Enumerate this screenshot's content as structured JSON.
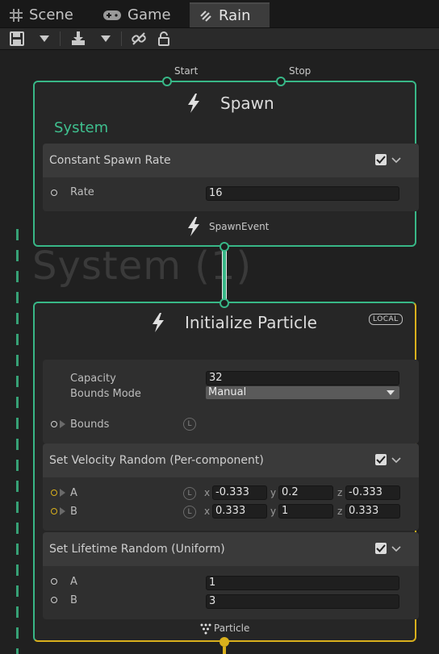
{
  "tabs": [
    {
      "label": "Scene",
      "icon": "grid-icon"
    },
    {
      "label": "Game",
      "icon": "gamepad-icon"
    },
    {
      "label": "Rain",
      "icon": "vfx-graph-icon"
    }
  ],
  "toolbar": {
    "icons": [
      "save-icon",
      "save-dropdown-icon",
      "import-icon",
      "import-dropdown-icon",
      "link-icon",
      "lock-icon"
    ]
  },
  "graph": {
    "system_watermark": "System (1)"
  },
  "spawn_node": {
    "title": "Spawn",
    "start_label": "Start",
    "stop_label": "Stop",
    "system_label": "System",
    "block": {
      "title": "Constant Spawn Rate",
      "enabled": true,
      "rate_label": "Rate",
      "rate_value": "16"
    },
    "output_label": "SpawnEvent"
  },
  "initialize_node": {
    "title": "Initialize Particle",
    "space_badge": "LOCAL",
    "capacity_label": "Capacity",
    "capacity_value": "32",
    "bounds_mode_label": "Bounds Mode",
    "bounds_mode_value": "Manual",
    "bounds_label": "Bounds",
    "local_badge": "L",
    "velocity_block": {
      "title": "Set Velocity Random (Per-component)",
      "enabled": true,
      "a_label": "A",
      "a": {
        "x": "-0.333",
        "y": "0.2",
        "z": "-0.333"
      },
      "b_label": "B",
      "b": {
        "x": "0.333",
        "y": "1",
        "z": "0.333"
      },
      "axis_x": "x",
      "axis_y": "y",
      "axis_z": "z"
    },
    "lifetime_block": {
      "title": "Set Lifetime Random (Uniform)",
      "enabled": true,
      "a_label": "A",
      "a_value": "1",
      "b_label": "B",
      "b_value": "3"
    },
    "output_label": "Particle"
  },
  "colors": {
    "spawn_border": "#38b787",
    "particle_border": "#d9b01c",
    "background": "#202020"
  }
}
